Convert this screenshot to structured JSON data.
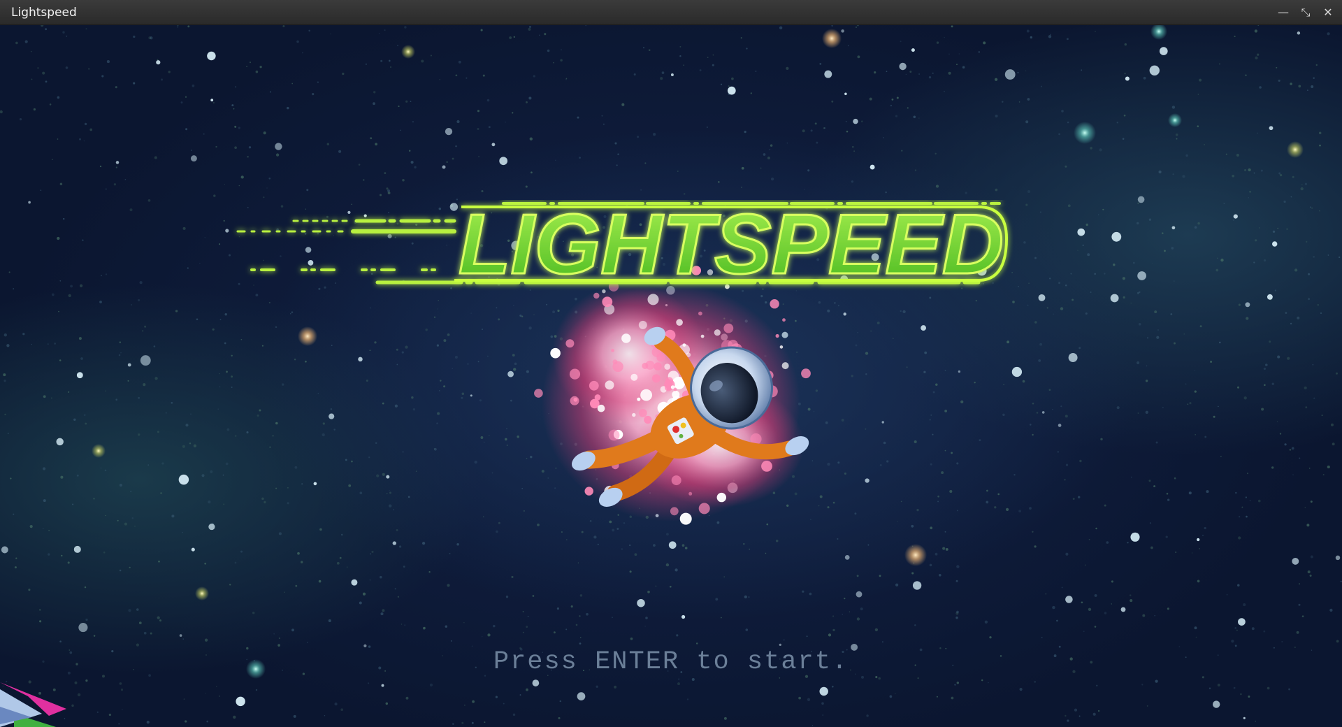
{
  "window": {
    "title": "Lightspeed",
    "minimize_glyph": "—",
    "restore_glyph": "⤡",
    "close_glyph": "✕"
  },
  "game": {
    "logo_text": "LIGHTSPEED",
    "prompt": "Press ENTER to start."
  },
  "icons": {
    "mascot": "astronaut-icon",
    "ship": "spaceship-icon"
  },
  "colors": {
    "logo_green": "#7fe030",
    "logo_outline": "#c8ff40",
    "prompt_gray": "#6b7f98",
    "suit_orange": "#e07a1c",
    "burst_pink": "#ff7fb0"
  }
}
